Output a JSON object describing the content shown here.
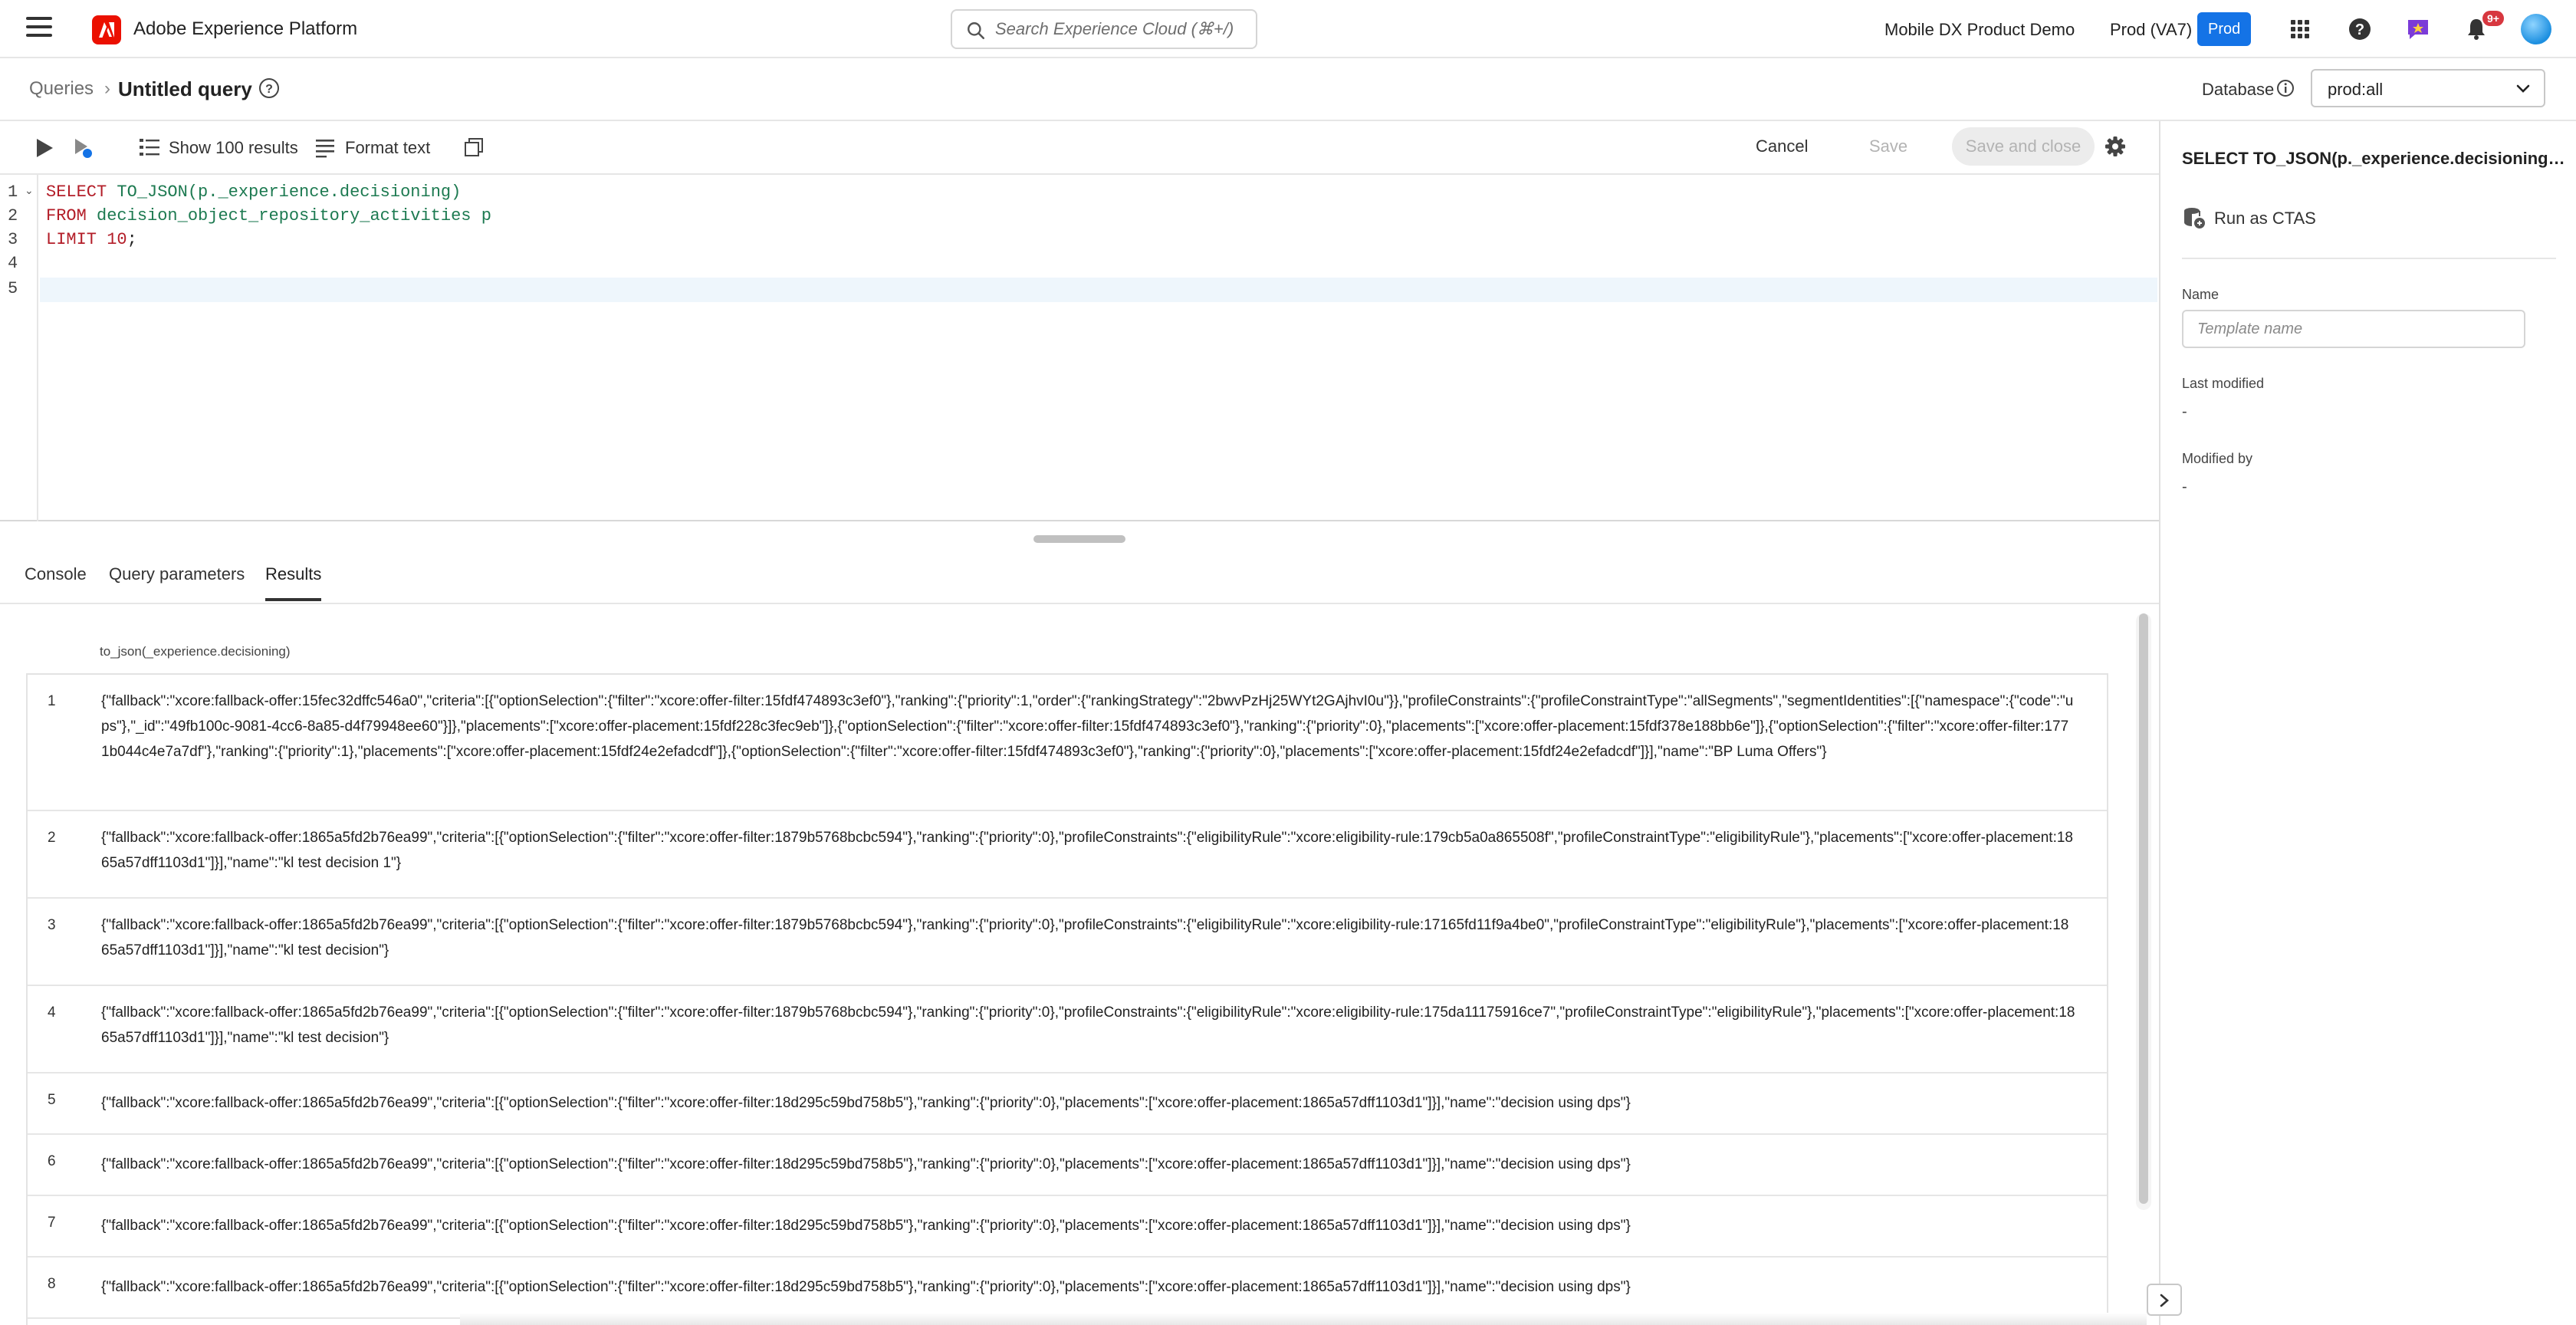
{
  "app": {
    "product_name": "Adobe Experience Platform",
    "org_name": "Mobile DX Product Demo",
    "sandbox_name": "Prod (VA7)",
    "sandbox_badge": "Prod",
    "notification_count": "9+",
    "accent_color": "#1473e6",
    "logo_color": "#eb1000"
  },
  "search": {
    "placeholder": "Search Experience Cloud (⌘+/)"
  },
  "breadcrumb": {
    "parent": "Queries",
    "separator": "›",
    "current": "Untitled query"
  },
  "database": {
    "label": "Database",
    "selected": "prod:all"
  },
  "toolbar": {
    "show_results_label": "Show 100 results",
    "format_text_label": "Format text",
    "cancel_label": "Cancel",
    "save_label": "Save",
    "save_close_label": "Save and close"
  },
  "editor": {
    "line_numbers": [
      "1",
      "2",
      "3",
      "4",
      "5"
    ],
    "line1_kw1": "SELECT",
    "line1_rest": " TO_JSON(p._experience.decisioning)",
    "line2_kw1": "FROM",
    "line2_rest": " decision_object_repository_activities p",
    "line3_kw1": "LIMIT",
    "line3_num": " 10",
    "line3_end": ";"
  },
  "tabs": {
    "console": "Console",
    "query_parameters": "Query parameters",
    "results": "Results",
    "active": "results"
  },
  "results": {
    "column_header": "to_json(_experience.decisioning)",
    "rows": [
      {
        "index": "1",
        "value": "{\"fallback\":\"xcore:fallback-offer:15fec32dffc546a0\",\"criteria\":[{\"optionSelection\":{\"filter\":\"xcore:offer-filter:15fdf474893c3ef0\"},\"ranking\":{\"priority\":1,\"order\":{\"rankingStrategy\":\"2bwvPzHj25WYt2GAjhvI0u\"}},\"profileConstraints\":{\"profileConstraintType\":\"allSegments\",\"segmentIdentities\":[{\"namespace\":{\"code\":\"ups\"},\"_id\":\"49fb100c-9081-4cc6-8a85-d4f79948ee60\"}]},\"placements\":[\"xcore:offer-placement:15fdf228c3fec9eb\"]},{\"optionSelection\":{\"filter\":\"xcore:offer-filter:15fdf474893c3ef0\"},\"ranking\":{\"priority\":0},\"placements\":[\"xcore:offer-placement:15fdf378e188bb6e\"]},{\"optionSelection\":{\"filter\":\"xcore:offer-filter:1771b044c4e7a7df\"},\"ranking\":{\"priority\":1},\"placements\":[\"xcore:offer-placement:15fdf24e2efadcdf\"]},{\"optionSelection\":{\"filter\":\"xcore:offer-filter:15fdf474893c3ef0\"},\"ranking\":{\"priority\":0},\"placements\":[\"xcore:offer-placement:15fdf24e2efadcdf\"]}],\"name\":\"BP Luma Offers\"}"
      },
      {
        "index": "2",
        "value": "{\"fallback\":\"xcore:fallback-offer:1865a5fd2b76ea99\",\"criteria\":[{\"optionSelection\":{\"filter\":\"xcore:offer-filter:1879b5768bcbc594\"},\"ranking\":{\"priority\":0},\"profileConstraints\":{\"eligibilityRule\":\"xcore:eligibility-rule:179cb5a0a865508f\",\"profileConstraintType\":\"eligibilityRule\"},\"placements\":[\"xcore:offer-placement:1865a57dff1103d1\"]}],\"name\":\"kl test decision 1\"}"
      },
      {
        "index": "3",
        "value": "{\"fallback\":\"xcore:fallback-offer:1865a5fd2b76ea99\",\"criteria\":[{\"optionSelection\":{\"filter\":\"xcore:offer-filter:1879b5768bcbc594\"},\"ranking\":{\"priority\":0},\"profileConstraints\":{\"eligibilityRule\":\"xcore:eligibility-rule:17165fd11f9a4be0\",\"profileConstraintType\":\"eligibilityRule\"},\"placements\":[\"xcore:offer-placement:1865a57dff1103d1\"]}],\"name\":\"kl test decision\"}"
      },
      {
        "index": "4",
        "value": "{\"fallback\":\"xcore:fallback-offer:1865a5fd2b76ea99\",\"criteria\":[{\"optionSelection\":{\"filter\":\"xcore:offer-filter:1879b5768bcbc594\"},\"ranking\":{\"priority\":0},\"profileConstraints\":{\"eligibilityRule\":\"xcore:eligibility-rule:175da11175916ce7\",\"profileConstraintType\":\"eligibilityRule\"},\"placements\":[\"xcore:offer-placement:1865a57dff1103d1\"]}],\"name\":\"kl test decision\"}"
      },
      {
        "index": "5",
        "value": "{\"fallback\":\"xcore:fallback-offer:1865a5fd2b76ea99\",\"criteria\":[{\"optionSelection\":{\"filter\":\"xcore:offer-filter:18d295c59bd758b5\"},\"ranking\":{\"priority\":0},\"placements\":[\"xcore:offer-placement:1865a57dff1103d1\"]}],\"name\":\"decision using dps\"}"
      },
      {
        "index": "6",
        "value": "{\"fallback\":\"xcore:fallback-offer:1865a5fd2b76ea99\",\"criteria\":[{\"optionSelection\":{\"filter\":\"xcore:offer-filter:18d295c59bd758b5\"},\"ranking\":{\"priority\":0},\"placements\":[\"xcore:offer-placement:1865a57dff1103d1\"]}],\"name\":\"decision using dps\"}"
      },
      {
        "index": "7",
        "value": "{\"fallback\":\"xcore:fallback-offer:1865a5fd2b76ea99\",\"criteria\":[{\"optionSelection\":{\"filter\":\"xcore:offer-filter:18d295c59bd758b5\"},\"ranking\":{\"priority\":0},\"placements\":[\"xcore:offer-placement:1865a57dff1103d1\"]}],\"name\":\"decision using dps\"}"
      },
      {
        "index": "8",
        "value": "{\"fallback\":\"xcore:fallback-offer:1865a5fd2b76ea99\",\"criteria\":[{\"optionSelection\":{\"filter\":\"xcore:offer-filter:18d295c59bd758b5\"},\"ranking\":{\"priority\":0},\"placements\":[\"xcore:offer-placement:1865a57dff1103d1\"]}],\"name\":\"decision using dps\"}"
      }
    ]
  },
  "right_panel": {
    "title": "SELECT TO_JSON(p._experience.decisioning)...",
    "run_ctas_label": "Run as CTAS",
    "name_label": "Name",
    "name_placeholder": "Template name",
    "last_modified_label": "Last modified",
    "last_modified_value": "-",
    "modified_by_label": "Modified by",
    "modified_by_value": "-"
  },
  "icons": [
    "menu-icon",
    "adobe-logo-icon",
    "search-icon",
    "apps-grid-icon",
    "help-icon",
    "feedback-icon",
    "bell-icon",
    "info-icon",
    "chevron-down-icon",
    "play-icon",
    "run-selected-icon",
    "list-icon",
    "format-text-icon",
    "copy-icon",
    "gear-icon",
    "ctas-icon",
    "chevron-right-icon"
  ]
}
